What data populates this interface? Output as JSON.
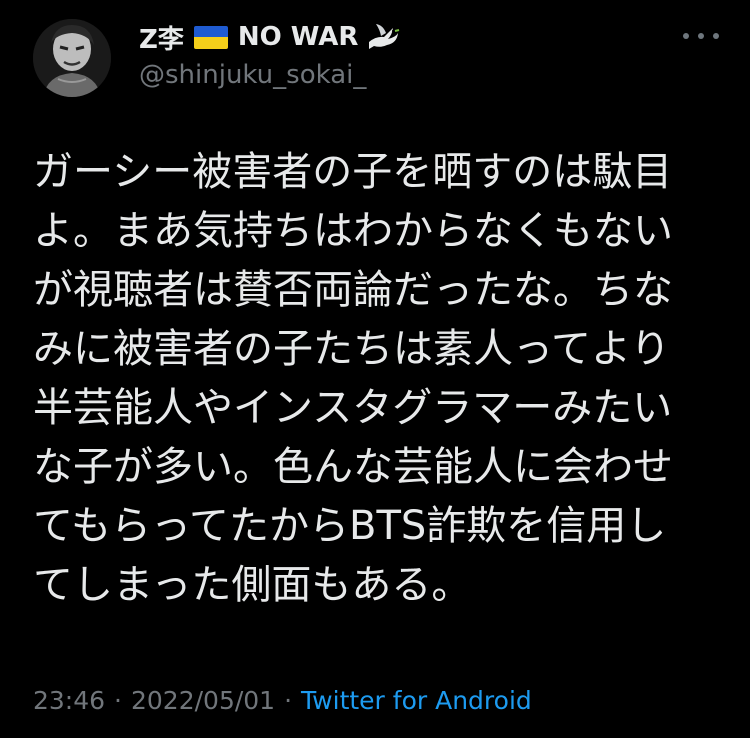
{
  "user": {
    "name": "Z李",
    "name_suffix": "NO WAR",
    "handle": "@shinjuku_sokai_",
    "flag_colors": [
      "#1f5bd1",
      "#f5cf1a"
    ]
  },
  "tweet": {
    "lines": [
      "ガーシー被害者の子を晒すのは駄目",
      "よ。まあ気持ちはわからなくもない",
      "が視聴者は賛否両論だったな。ちな",
      "みに被害者の子たちは素人ってより",
      "半芸能人やインスタグラマーみたい",
      "な子が多い。色んな芸能人に会わせ",
      "てもらってたからBTS詐欺を信用し",
      "てしまった側面もある。"
    ]
  },
  "meta": {
    "time": "23:46",
    "separator": "·",
    "date": "2022/05/01",
    "source": "Twitter for Android"
  },
  "colors": {
    "background": "#000000",
    "text": "#e7e9ea",
    "secondary": "#71767b",
    "link": "#1d9bf0"
  },
  "icons": {
    "more": "more-horizontal-icon",
    "dove": "dove-icon",
    "flag": "ukraine-flag-icon"
  }
}
